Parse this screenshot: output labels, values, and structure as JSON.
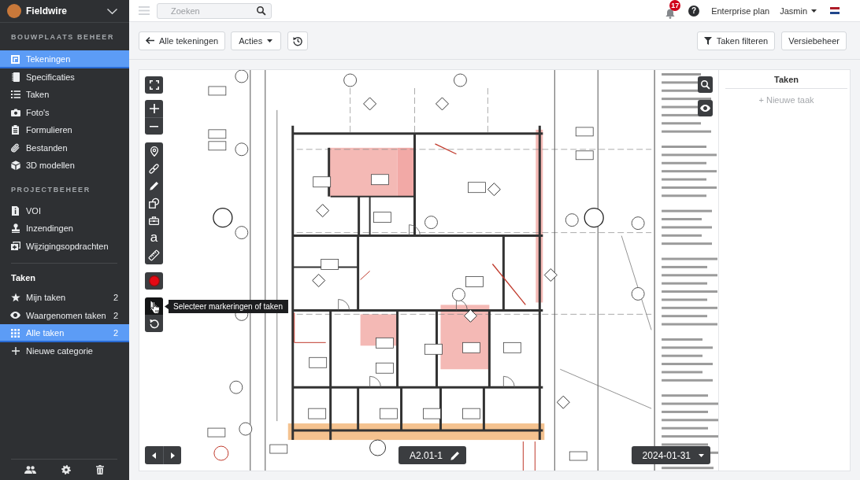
{
  "sidebar": {
    "brand": "Fieldwire",
    "sections": [
      {
        "title": "BOUWPLAATS BEHEER",
        "items": [
          {
            "label": "Tekeningen",
            "selected": true
          },
          {
            "label": "Specificaties",
            "selected": false
          },
          {
            "label": "Taken",
            "selected": false
          },
          {
            "label": "Foto's",
            "selected": false
          },
          {
            "label": "Formulieren",
            "selected": false
          },
          {
            "label": "Bestanden",
            "selected": false
          },
          {
            "label": "3D modellen",
            "selected": false
          }
        ]
      },
      {
        "title": "PROJECTBEHEER",
        "items": [
          {
            "label": "VOI",
            "selected": false
          },
          {
            "label": "Inzendingen",
            "selected": false
          },
          {
            "label": "Wijzigingsopdrachten",
            "selected": false
          }
        ]
      }
    ],
    "tasks": {
      "title": "Taken",
      "items": [
        {
          "label": "Mijn taken",
          "count": "2",
          "selected": false
        },
        {
          "label": "Waargenomen taken",
          "count": "2",
          "selected": false
        },
        {
          "label": "Alle taken",
          "count": "2",
          "selected": true
        }
      ],
      "new_category": "Nieuwe categorie"
    }
  },
  "topbar": {
    "search": {
      "placeholder": "Zoeken"
    },
    "notifications": {
      "count": "17"
    },
    "help": "?",
    "plan": "Enterprise plan",
    "user": "Jasmin"
  },
  "toolbar": {
    "back": "Alle tekeningen",
    "actions": "Acties",
    "filter": "Taken filteren",
    "versions": "Versiebeheer"
  },
  "viewer": {
    "markup_tools": [
      {
        "kind": "pin"
      },
      {
        "kind": "link"
      },
      {
        "kind": "pencil"
      },
      {
        "kind": "shapes"
      },
      {
        "kind": "toolbox"
      },
      {
        "kind": "text",
        "label": "a"
      },
      {
        "kind": "ruler"
      }
    ],
    "select_tool": {
      "selected": true
    },
    "tooltip": "Selecteer markeringen of taken",
    "sheet": "A2.01-1",
    "version_date": "2024-01-31"
  },
  "task_panel": {
    "title": "Taken",
    "new_task": "+ Nieuwe taak"
  }
}
